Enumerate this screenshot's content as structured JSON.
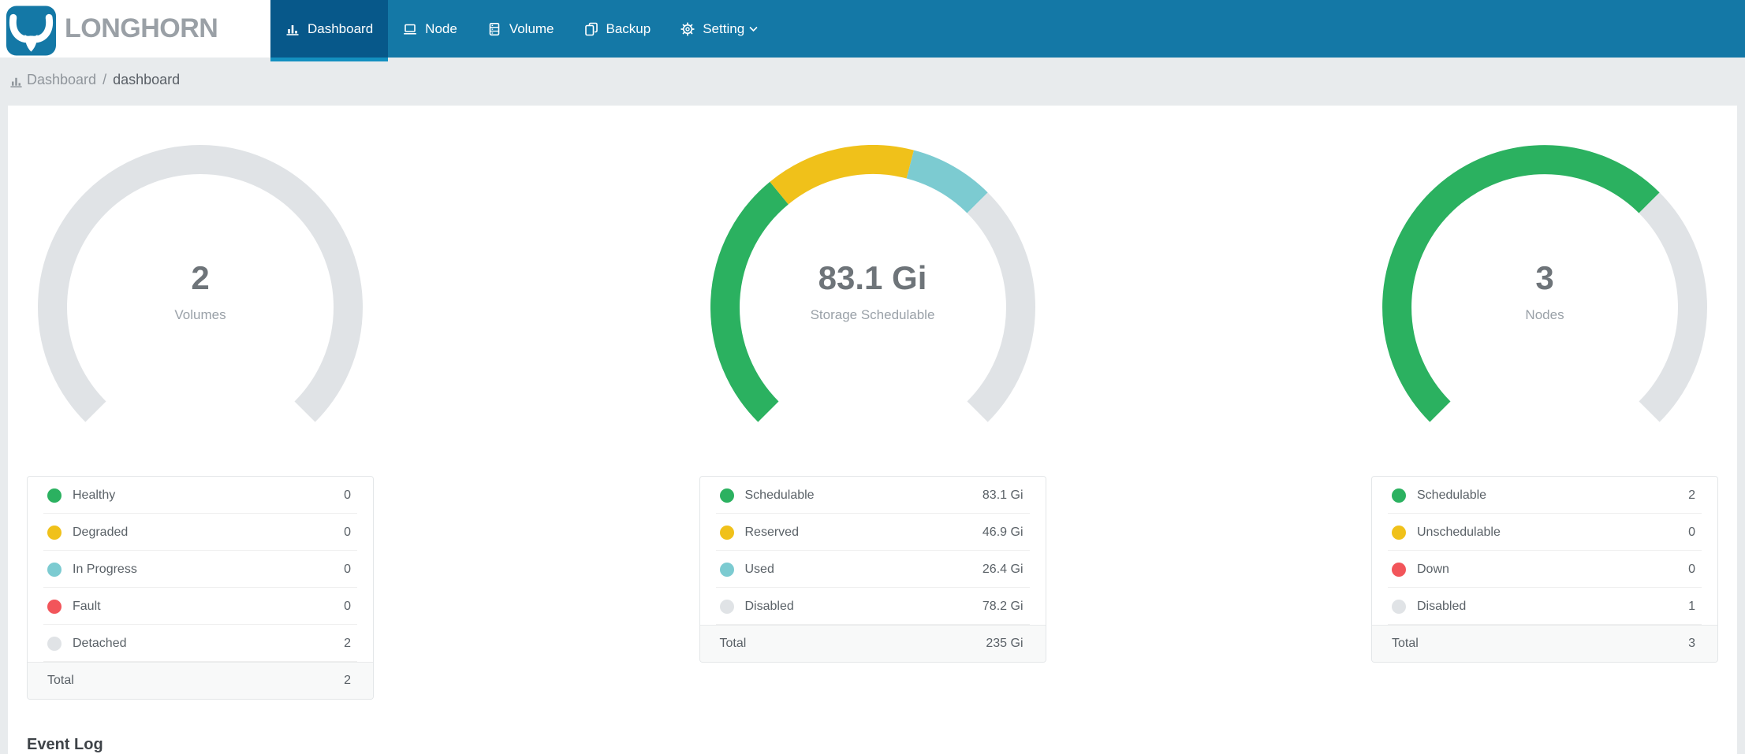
{
  "brand": {
    "name": "LONGHORN"
  },
  "nav": {
    "items": [
      {
        "label": "Dashboard",
        "icon": "bar-chart-icon",
        "active": true
      },
      {
        "label": "Node",
        "icon": "laptop-icon",
        "active": false
      },
      {
        "label": "Volume",
        "icon": "database-icon",
        "active": false
      },
      {
        "label": "Backup",
        "icon": "copy-icon",
        "active": false
      },
      {
        "label": "Setting",
        "icon": "gear-icon",
        "active": false,
        "dropdown": true
      }
    ]
  },
  "breadcrumb": {
    "section": "Dashboard",
    "separator": "/",
    "page": "dashboard"
  },
  "event_log": {
    "title": "Event Log"
  },
  "colors": {
    "nav_bg": "#1478a6",
    "nav_active_bg": "#07588a",
    "nav_active_underline": "#1390c0",
    "brand_text": "#9aa0a6",
    "green": "#2bb160",
    "yellow": "#f0c11a",
    "teal": "#7ccbd1",
    "red": "#f2555a",
    "ring_gray": "#e0e3e6"
  },
  "chart_data": [
    {
      "type": "gauge",
      "center_value": "2",
      "center_label": "Volumes",
      "start_angle": 225,
      "sweep_angle": 270,
      "segments": [
        {
          "label": "Healthy",
          "value": 0,
          "display": "0",
          "color": "#2bb160"
        },
        {
          "label": "Degraded",
          "value": 0,
          "display": "0",
          "color": "#f0c11a"
        },
        {
          "label": "In Progress",
          "value": 0,
          "display": "0",
          "color": "#7ccbd1"
        },
        {
          "label": "Fault",
          "value": 0,
          "display": "0",
          "color": "#f2555a"
        },
        {
          "label": "Detached",
          "value": 2,
          "display": "2",
          "color": "#e0e3e6"
        }
      ],
      "total": {
        "label": "Total",
        "display": "2"
      }
    },
    {
      "type": "gauge",
      "center_value": "83.1 Gi",
      "center_label": "Storage Schedulable",
      "start_angle": 225,
      "sweep_angle": 270,
      "segments": [
        {
          "label": "Schedulable",
          "value": 83.1,
          "display": "83.1 Gi",
          "color": "#2bb160"
        },
        {
          "label": "Reserved",
          "value": 46.9,
          "display": "46.9 Gi",
          "color": "#f0c11a"
        },
        {
          "label": "Used",
          "value": 26.4,
          "display": "26.4 Gi",
          "color": "#7ccbd1"
        },
        {
          "label": "Disabled",
          "value": 78.2,
          "display": "78.2 Gi",
          "color": "#e0e3e6"
        }
      ],
      "total": {
        "label": "Total",
        "display": "235 Gi"
      }
    },
    {
      "type": "gauge",
      "center_value": "3",
      "center_label": "Nodes",
      "start_angle": 225,
      "sweep_angle": 270,
      "segments": [
        {
          "label": "Schedulable",
          "value": 2,
          "display": "2",
          "color": "#2bb160"
        },
        {
          "label": "Unschedulable",
          "value": 0,
          "display": "0",
          "color": "#f0c11a"
        },
        {
          "label": "Down",
          "value": 0,
          "display": "0",
          "color": "#f2555a"
        },
        {
          "label": "Disabled",
          "value": 1,
          "display": "1",
          "color": "#e0e3e6"
        }
      ],
      "total": {
        "label": "Total",
        "display": "3"
      }
    }
  ]
}
